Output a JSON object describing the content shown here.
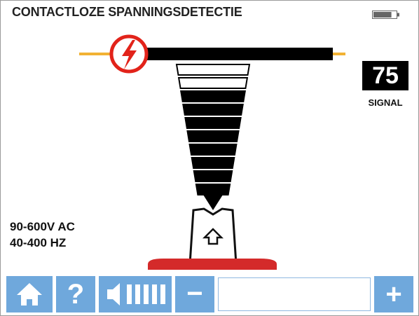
{
  "header": {
    "title": "CONTACTLOZE SPANNINGSDETECTIE"
  },
  "battery": {
    "icon": "battery-icon",
    "level": 0.8
  },
  "signal": {
    "value": "75",
    "label": "SIGNAL",
    "bars_active": 8,
    "bars_total": 10
  },
  "range": {
    "voltage": "90-600V AC",
    "frequency": "40-400 HZ"
  },
  "toolbar": {
    "home_icon": "home-icon",
    "help_label": "?",
    "volume_icon": "volume-icon",
    "minus_label": "−",
    "plus_label": "+",
    "volume_level": 0
  },
  "colors": {
    "accent": "#6fa8dc",
    "warning_red": "#e2231a",
    "base_red": "#d42a2a",
    "wire_tip": "#f2b233"
  }
}
